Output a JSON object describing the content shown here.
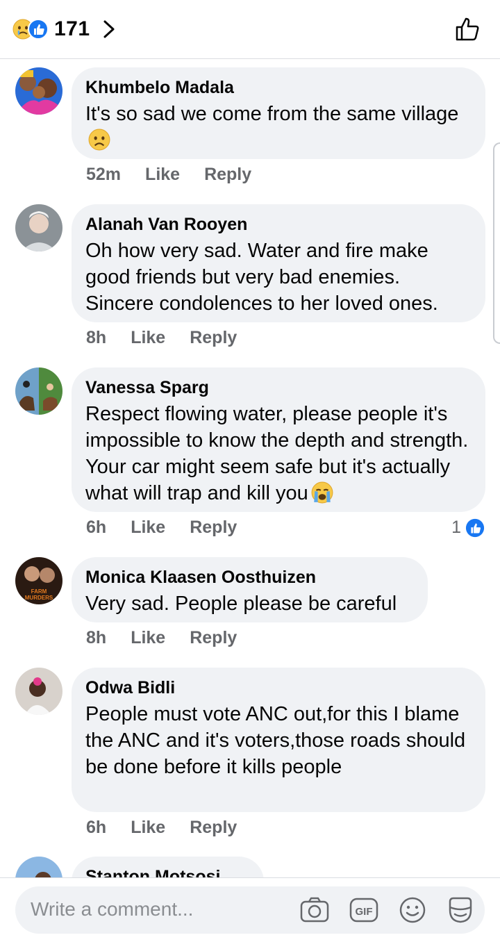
{
  "header": {
    "reaction_count": "171",
    "icons": [
      "sad-reaction-icon",
      "like-reaction-icon",
      "chevron-right-icon",
      "thumbs-up-outline-icon"
    ]
  },
  "comments": [
    {
      "author": "Khumbelo Madala",
      "text": "It's so sad we come from the same village",
      "emoji": "sad-face-emoji",
      "time": "52m",
      "like": "Like",
      "reply": "Reply"
    },
    {
      "author": "Alanah Van Rooyen",
      "text": "Oh how very sad. Water and fire make good friends but very bad enemies. Sincere condolences to her loved ones.",
      "time": "8h",
      "like": "Like",
      "reply": "Reply"
    },
    {
      "author": "Vanessa Sparg",
      "text": "Respect flowing water, please people it's impossible to know the depth and strength. Your car might seem safe but it's actually what will trap and kill you",
      "emoji": "crying-face-emoji",
      "time": "6h",
      "like": "Like",
      "reply": "Reply",
      "likes": "1"
    },
    {
      "author": "Monica Klaasen Oosthuizen",
      "text": "Very sad. People please be careful",
      "avatar_text": "FARM MURDERS",
      "time": "8h",
      "like": "Like",
      "reply": "Reply"
    },
    {
      "author": "Odwa Bidli",
      "text": "People must vote ANC out,for this I blame the ANC and it's voters,those roads should be done before it kills people",
      "time": "6h",
      "like": "Like",
      "reply": "Reply"
    },
    {
      "author": "Stanton Motsosi"
    }
  ],
  "composer": {
    "placeholder": "Write a comment...",
    "icons": [
      "camera-icon",
      "gif-icon",
      "emoji-icon",
      "sticker-icon"
    ],
    "gif_label": "GIF"
  },
  "colors": {
    "like_blue": "#1877f2",
    "bubble_bg": "#f0f2f5",
    "meta_gray": "#65676b"
  }
}
